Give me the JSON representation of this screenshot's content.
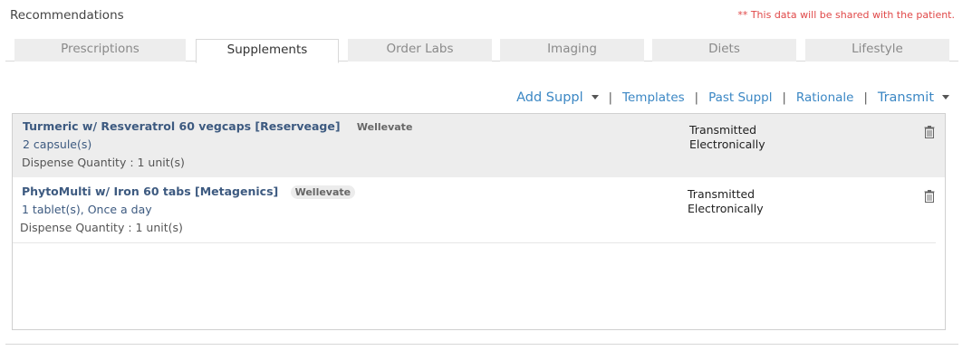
{
  "header": {
    "title": "Recommendations",
    "notice": "** This data will be shared with the patient."
  },
  "tabs": [
    {
      "label": "Prescriptions",
      "active": false
    },
    {
      "label": "Supplements",
      "active": true
    },
    {
      "label": "Order Labs",
      "active": false
    },
    {
      "label": "Imaging",
      "active": false
    },
    {
      "label": "Diets",
      "active": false
    },
    {
      "label": "Lifestyle",
      "active": false
    }
  ],
  "actions": {
    "add_suppl": "Add Suppl",
    "templates": "Templates",
    "past_suppl": "Past Suppl",
    "rationale": "Rationale",
    "transmit": "Transmit",
    "separator": "|"
  },
  "supplements": [
    {
      "name": "Turmeric w/ Resveratrol 60 vegcaps [Reserveage]",
      "vendor": "Wellevate",
      "dose": "2 capsule(s)",
      "quantity": "Dispense Quantity : 1 unit(s)",
      "status_line1": "Transmitted",
      "status_line2": "Electronically",
      "delete_icon": "trash-icon"
    },
    {
      "name": "PhytoMulti w/ Iron 60 tabs [Metagenics]",
      "vendor": "Wellevate",
      "dose": "1 tablet(s),  Once a day",
      "quantity": "Dispense Quantity : 1 unit(s)",
      "status_line1": "Transmitted",
      "status_line2": "Electronically",
      "delete_icon": "trash-icon"
    }
  ],
  "colors": {
    "link": "#3b87c4",
    "notice": "#e04848",
    "item_title": "#3d5a80",
    "selected_row": "#ededed"
  }
}
